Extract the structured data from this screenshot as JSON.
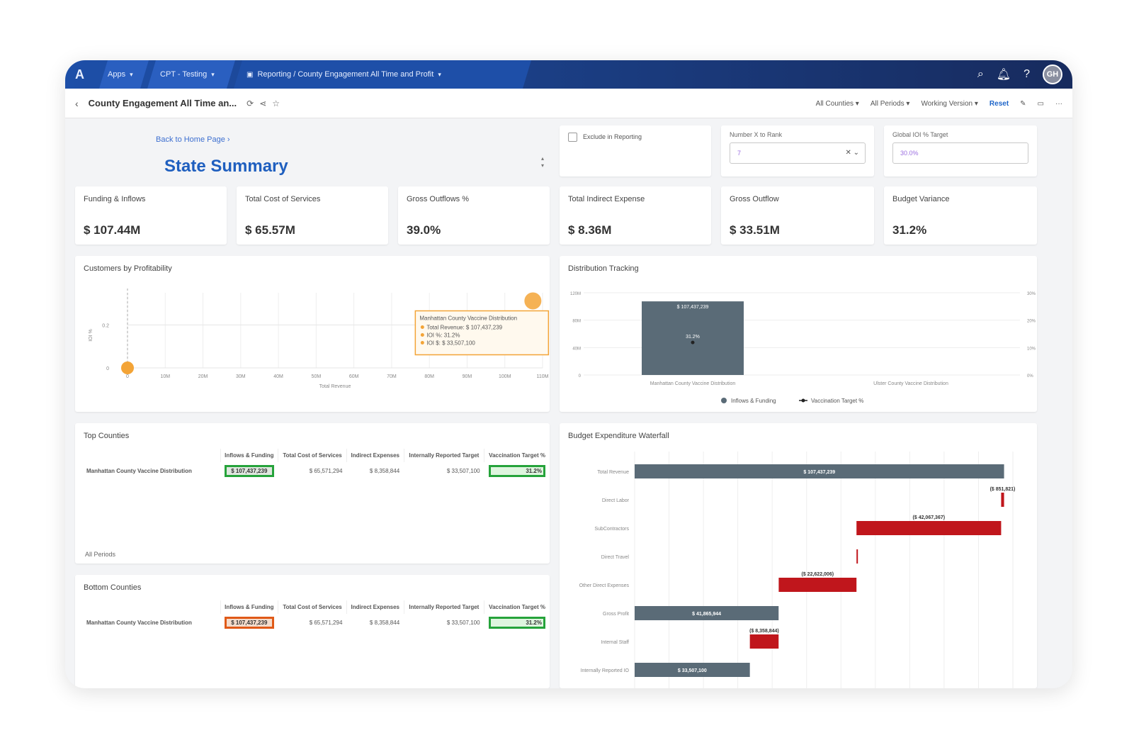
{
  "topbar": {
    "logo": "A",
    "apps_label": "Apps",
    "workspace_label": "CPT - Testing",
    "report_path": "Reporting / County Engagement All Time and Profit",
    "user_initials": "GH"
  },
  "subbar": {
    "page_name": "County Engagement All Time an...",
    "filters": [
      "All Counties",
      "All Periods",
      "Working Version"
    ],
    "reset_label": "Reset"
  },
  "header": {
    "back_link": "Back to Home Page",
    "title": "State Summary"
  },
  "controls": {
    "exclude_label": "Exclude in Reporting",
    "rank_label": "Number X to Rank",
    "rank_value": "7",
    "target_label": "Global IOI % Target",
    "target_value": "30.0%"
  },
  "kpis": [
    {
      "label": "Funding & Inflows",
      "value": "$ 107.44M"
    },
    {
      "label": "Total Cost of Services",
      "value": "$ 65.57M"
    },
    {
      "label": "Gross Outflows %",
      "value": "39.0%"
    },
    {
      "label": "Total Indirect Expense",
      "value": "$ 8.36M"
    },
    {
      "label": "Gross Outflow",
      "value": "$ 33.51M"
    },
    {
      "label": "Budget Variance",
      "value": "31.2%"
    }
  ],
  "scatter": {
    "title": "Customers by Profitability",
    "xlabel": "Total Revenue",
    "ylabel": "IOI %",
    "tooltip": {
      "title": "Manhattan County Vaccine Distribution",
      "lines": [
        "Total Revenue: $ 107,437,239",
        "IOI %: 31.2%",
        "IOI $: $ 33,507,100"
      ]
    }
  },
  "distribution": {
    "title": "Distribution Tracking",
    "bar_label": "$ 107,437,239",
    "point_label": "31.2%",
    "legend": [
      "Inflows & Funding",
      "Vaccination Target %"
    ]
  },
  "top_counties": {
    "title": "Top Counties",
    "columns": [
      "Inflows & Funding",
      "Total Cost of Services",
      "Indirect Expenses",
      "Internally Reported Target",
      "Vaccination Target %"
    ],
    "rows": [
      [
        "Manhattan County Vaccine Distribution",
        "$ 107,437,239",
        "$ 65,571,294",
        "$ 8,358,844",
        "$ 33,507,100",
        "31.2%"
      ]
    ],
    "footer": "All Periods"
  },
  "bottom_counties": {
    "title": "Bottom Counties",
    "columns": [
      "Inflows & Funding",
      "Total Cost of Services",
      "Indirect Expenses",
      "Internally Reported Target",
      "Vaccination Target %"
    ],
    "rows": [
      [
        "Manhattan County Vaccine Distribution",
        "$ 107,437,239",
        "$ 65,571,294",
        "$ 8,358,844",
        "$ 33,507,100",
        "31.2%"
      ]
    ]
  },
  "waterfall": {
    "title": "Budget Expenditure Waterfall"
  },
  "chart_data": [
    {
      "type": "scatter",
      "title": "Customers by Profitability",
      "xlabel": "Total Revenue",
      "ylabel": "IOI %",
      "x_ticks": [
        "0",
        "10M",
        "20M",
        "30M",
        "40M",
        "50M",
        "60M",
        "70M",
        "80M",
        "90M",
        "100M",
        "110M"
      ],
      "y_ticks": [
        "0",
        "0.2"
      ],
      "xlim": [
        0,
        110000000
      ],
      "ylim": [
        0,
        0.35
      ],
      "points": [
        {
          "x": 0,
          "y": 0
        },
        {
          "x": 107437239,
          "y": 0.312
        }
      ]
    },
    {
      "type": "bar",
      "title": "Distribution Tracking",
      "categories": [
        "Manhattan County Vaccine Distribution",
        "Ulster County Vaccine Distribution"
      ],
      "y_ticks": [
        "0",
        "40M",
        "80M",
        "120M"
      ],
      "ylim": [
        0,
        120000000
      ],
      "series": [
        {
          "name": "Inflows & Funding",
          "values": [
            107437239,
            0
          ]
        },
        {
          "name": "Vaccination Target %",
          "values": [
            0.312,
            null
          ]
        }
      ]
    },
    {
      "type": "bar",
      "title": "Budget Expenditure Waterfall",
      "categories": [
        "Total Revenue",
        "Direct Labor",
        "SubContractors",
        "Direct Travel",
        "Other Direct Expenses",
        "Gross Profit",
        "Internal Staff",
        "Internally Reported IO"
      ],
      "steps": [
        {
          "label": "$ 107,437,239",
          "start": 0,
          "end": 107437239,
          "kind": "total"
        },
        {
          "label": "($ 851,821)",
          "start": 107437239,
          "end": 106585418,
          "kind": "decrease"
        },
        {
          "label": "($ 42,067,367)",
          "start": 106585418,
          "end": 64518051,
          "kind": "decrease"
        },
        {
          "label": "",
          "start": 64518051,
          "end": 64518051,
          "kind": "decrease"
        },
        {
          "label": "($ 22,622,006)",
          "start": 64518051,
          "end": 41896045,
          "kind": "decrease"
        },
        {
          "label": "$ 41,865,944",
          "start": 0,
          "end": 41865944,
          "kind": "total"
        },
        {
          "label": "($ 8,358,844)",
          "start": 41865944,
          "end": 33507100,
          "kind": "decrease"
        },
        {
          "label": "$ 33,507,100",
          "start": 0,
          "end": 33507100,
          "kind": "total"
        }
      ],
      "xlim": [
        0,
        110000000
      ],
      "colors": {
        "total": "#5a6b77",
        "decrease": "#c0161c"
      }
    }
  ]
}
